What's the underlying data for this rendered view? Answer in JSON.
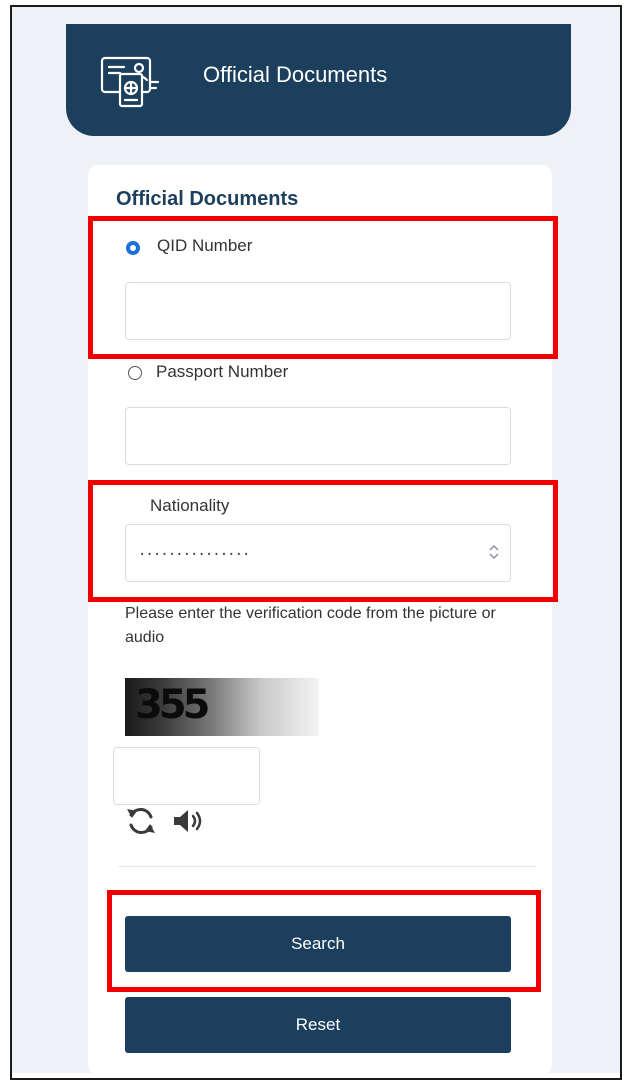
{
  "header": {
    "title": "Official Documents",
    "icon": "documents-icon",
    "background": "#1b3f5c"
  },
  "form": {
    "title": "Official Documents",
    "qid": {
      "label": "QID Number",
      "selected": true,
      "value": "",
      "placeholder": ""
    },
    "passport": {
      "label": "Passport Number",
      "selected": false,
      "value": "",
      "placeholder": ""
    },
    "nationality": {
      "label": "Nationality",
      "selected_value": "..............."
    },
    "captcha": {
      "instructions": "Please enter the verification code from the picture or audio",
      "image_text": "355",
      "input_value": "",
      "refresh_icon": "refresh-icon",
      "audio_icon": "speaker-icon"
    },
    "buttons": {
      "search": "Search",
      "reset": "Reset"
    }
  },
  "colors": {
    "primary": "#1b3f5c",
    "radio_selected": "#1e6fd9",
    "highlight": "#f20000",
    "page_background": "#eef2f6"
  }
}
